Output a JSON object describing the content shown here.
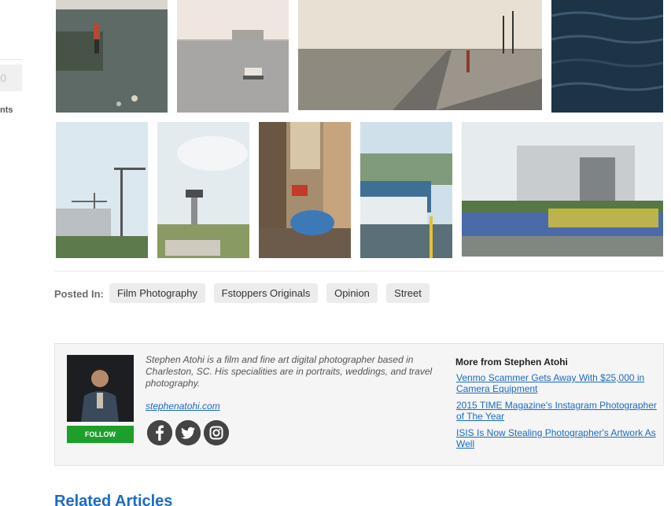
{
  "sidebar": {
    "count": "0",
    "label": "nts"
  },
  "gallery": {
    "row1": [
      {
        "name": "photo-shoreline-fisherman",
        "sky": "#d9d6cf",
        "water": "#5e6a66"
      },
      {
        "name": "photo-harbor-boat",
        "sky": "#efe6df",
        "water": "#a7a6a4"
      },
      {
        "name": "photo-malecon-seawall",
        "sky": "#e8e0d2",
        "water": "#8f8a80"
      },
      {
        "name": "photo-dark-water",
        "sky": "#2f4a5f",
        "water": "#1d3447"
      }
    ],
    "row2": [
      {
        "name": "photo-construction-cranes",
        "sky": "#dbe8ef",
        "ground": "#5d7a4d"
      },
      {
        "name": "photo-control-tower",
        "sky": "#e4ebef",
        "ground": "#8a9a63"
      },
      {
        "name": "photo-street-vw-beetle",
        "sky": "#d7c6a8",
        "ground": "#6c5b4a"
      },
      {
        "name": "photo-classic-cars",
        "sky": "#cfe0ea",
        "ground": "#5a6f77"
      },
      {
        "name": "photo-revolution-square",
        "sky": "#e6ebee",
        "ground": "#4a6aa8"
      }
    ]
  },
  "posted_in": {
    "label": "Posted In:",
    "tags": [
      "Film Photography",
      "Fstoppers Originals",
      "Opinion",
      "Street"
    ]
  },
  "author": {
    "bio": "Stephen Atohi is a film and fine art digital photographer based in Charleston, SC. His specialities are in portraits, weddings, and travel photography.",
    "website": "stephenatohi.com",
    "follow_label": "FOLLOW",
    "social_icons": [
      "facebook-icon",
      "twitter-icon",
      "instagram-icon"
    ],
    "more_title": "More from Stephen Atohi",
    "more_links": [
      "Venmo Scammer Gets Away With $25,000 in Camera Equipment",
      "2015 TIME Magazine's Instagram Photographer of The Year",
      "ISIS Is Now Stealing Photographer's Artwork As Well"
    ]
  },
  "related": {
    "heading": "Related Articles"
  },
  "colors": {
    "link": "#1a6bc4",
    "follow_green": "#1e9e2a",
    "tag_bg": "#ececec"
  }
}
